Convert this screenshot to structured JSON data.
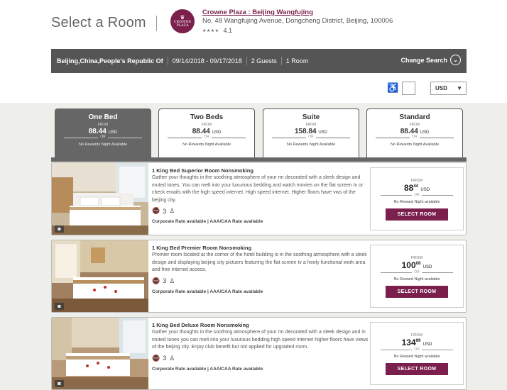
{
  "header": {
    "page_title": "Select a Room",
    "logo_text_top": "CROWNE",
    "logo_text_bottom": "PLAZA",
    "hotel_name": "Crowne Plaza : Beijing Wangfujing",
    "hotel_address": "No. 48 Wangfujing Avenue, Dongcheng District, Beijing, 100006",
    "hotel_stars": "★★★★",
    "hotel_rating": "4.1"
  },
  "search_bar": {
    "location": "Beijing,China,People's Republic Of",
    "dates": "09/14/2018 - 09/17/2018",
    "guests": "2 Guests",
    "rooms": "1 Room",
    "change_search_label": "Change Search"
  },
  "filters": {
    "currency": "USD"
  },
  "tabs": [
    {
      "name": "One Bed",
      "from": "FROM",
      "price": "88.44",
      "currency": "USD",
      "or": "OR",
      "no_rewards": "No Rewards Night Available"
    },
    {
      "name": "Two Beds",
      "from": "FROM",
      "price": "88.44",
      "currency": "USD",
      "or": "OR",
      "no_rewards": "No Rewards Night Available"
    },
    {
      "name": "Suite",
      "from": "FROM",
      "price": "158.84",
      "currency": "USD",
      "or": "OR",
      "no_rewards": "No Rewards Night Available"
    },
    {
      "name": "Standard",
      "from": "FROM",
      "price": "88.44",
      "currency": "USD",
      "or": "OR",
      "no_rewards": "No Rewards Night Available"
    }
  ],
  "rooms": [
    {
      "title": "1 King Bed Superior Room Nonsmoking",
      "description": "Gather your thoughts in the soothing atmosphere of your rm decorated with a sleek design and muted tones. You can melt into your luxurious bedding and watch movies on the flat screen tv or check emails with the high speed internet. High speed internet. Higher floors have vws of the beijing city.",
      "occupancy": "3",
      "rates": "Corporate Rate available | AAA/CAA Rate available",
      "from": "FROM",
      "price_whole": "88",
      "price_cents": "44",
      "or": "OR",
      "no_rewards": "No Reward Night available",
      "button": "SELECT ROOM"
    },
    {
      "title": "1 King Bed Premier Room Nonsmoking",
      "description": "Premier room located at the corner of the hotel building is in the soothing atmosphere with a sleek design and displaying beijing city pictuers featuring the flat screen tv a freely functional work area and free internet access.",
      "occupancy": "3",
      "rates": "Corporate Rate available | AAA/CAA Rate available",
      "from": "FROM",
      "price_whole": "100",
      "price_cents": "08",
      "or": "OR",
      "no_rewards": "No Reward Night available",
      "button": "SELECT ROOM"
    },
    {
      "title": "1 King Bed Deluxe Room Nonsmoking",
      "description": "Gather your thoughts in the soothing atmosphere of your rm decorated with a sleek design and in muted tones you can melt into your luxurious bedding high speed internet higher floors have views of the beijing city. Enjoy club benefit but not applied for upgraded room.",
      "occupancy": "3",
      "rates": "Corporate Rate available | AAA/CAA Rate available",
      "from": "FROM",
      "price_whole": "134",
      "price_cents": "99",
      "or": "OR",
      "no_rewards": "No Reward Night available",
      "button": "SELECT ROOM"
    }
  ],
  "price_currency": "USD",
  "colors": {
    "brand": "#7b1f4c",
    "search_bar": "#555555",
    "active_tab": "#666666",
    "background": "#eeeeea"
  }
}
